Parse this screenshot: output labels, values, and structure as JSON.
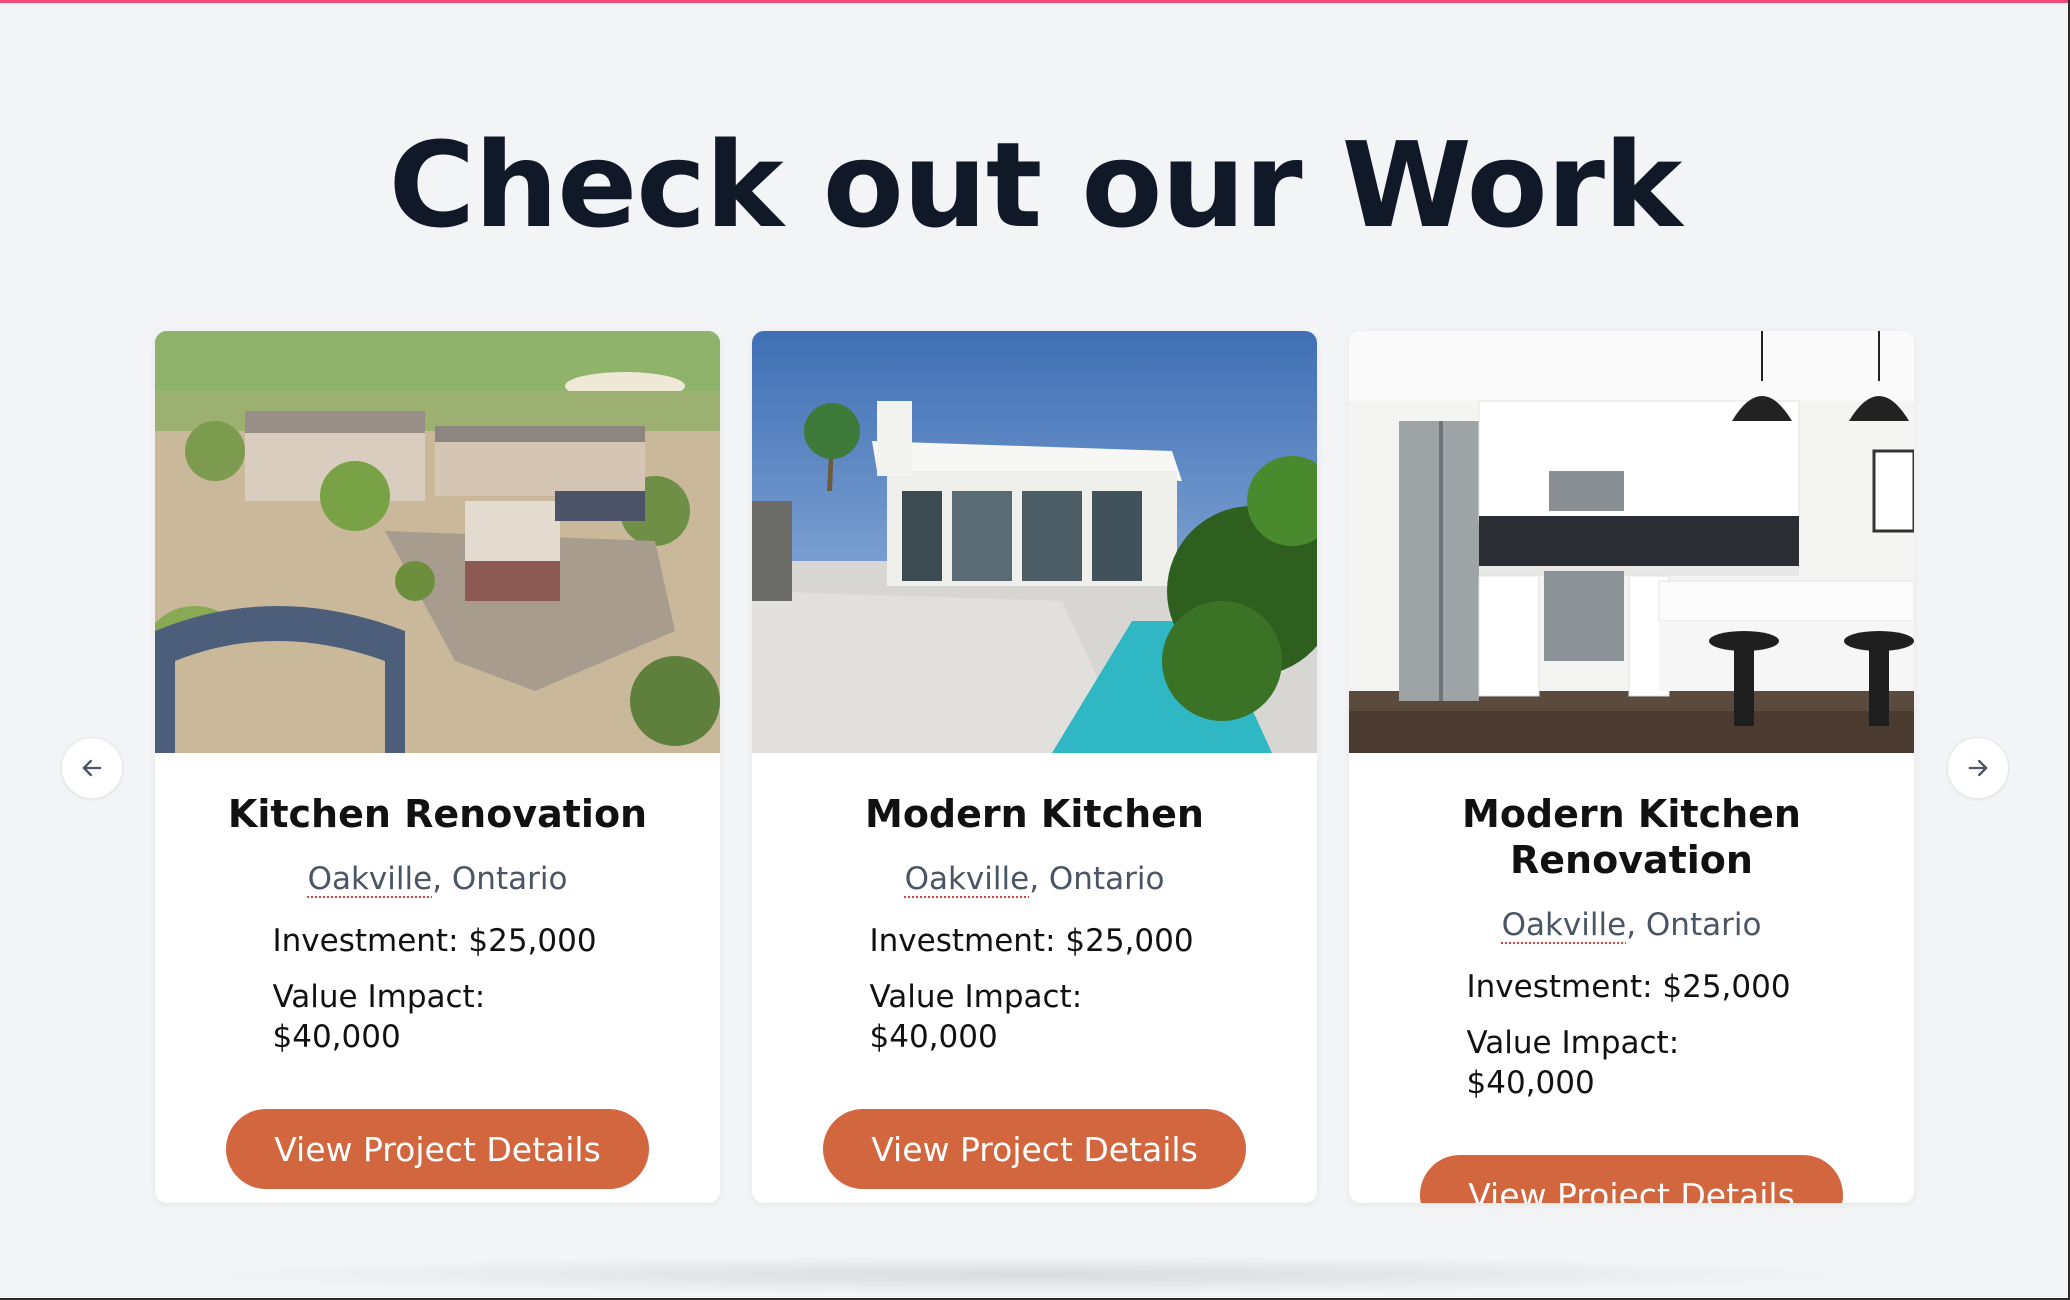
{
  "section": {
    "title": "Check out our Work"
  },
  "carousel": {
    "prev_icon": "arrow-left-icon",
    "next_icon": "arrow-right-icon"
  },
  "projects": [
    {
      "title": "Kitchen Renovation",
      "location_city": "Oakville",
      "location_rest": ", Ontario",
      "investment": "Investment: $25,000",
      "value_impact": "Value Impact: $40,000",
      "button_label": "View Project Details",
      "image": "aerial-desert-house"
    },
    {
      "title": "Modern Kitchen",
      "location_city": "Oakville",
      "location_rest": ", Ontario",
      "investment": "Investment: $25,000",
      "value_impact": "Value Impact: $40,000",
      "button_label": "View Project Details",
      "image": "modern-house-pool"
    },
    {
      "title": "Modern Kitchen Renovation",
      "location_city": "Oakville",
      "location_rest": ", Ontario",
      "investment": "Investment: $25,000",
      "value_impact": "Value Impact: $40,000",
      "button_label": "View Project Details",
      "image": "white-kitchen-interior"
    }
  ],
  "colors": {
    "accent": "#d2663f",
    "title": "#111827",
    "background": "#f3f4f6",
    "top_accent": "#f0497a"
  }
}
